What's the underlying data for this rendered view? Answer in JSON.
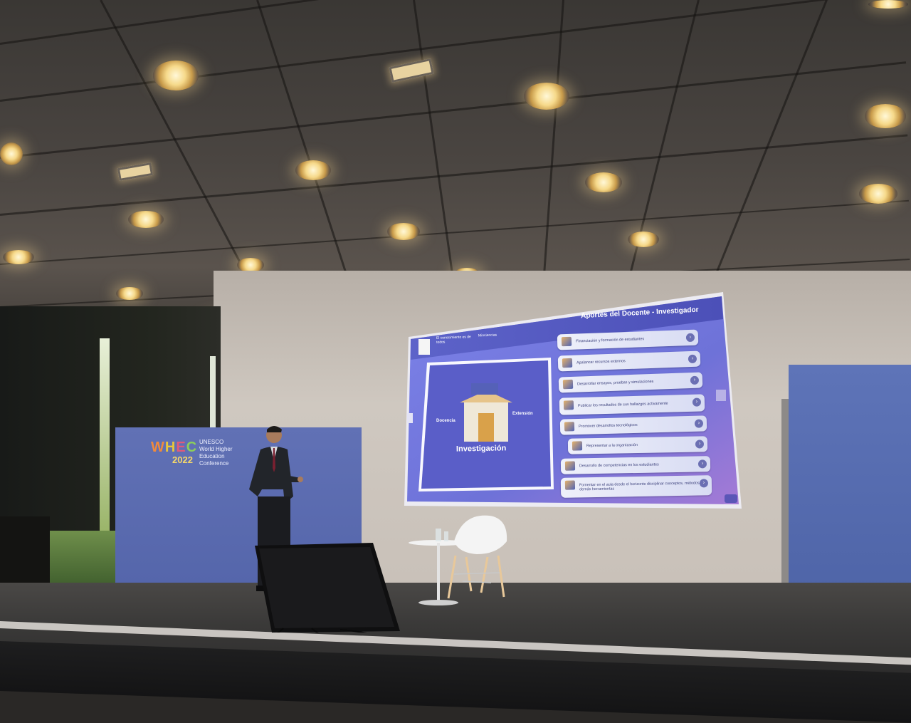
{
  "banner": {
    "logo_letters": [
      "W",
      "H",
      "E",
      "C"
    ],
    "year": "2022",
    "org_lines": [
      "UNESCO",
      "World Higher",
      "Education",
      "Conference"
    ]
  },
  "slide": {
    "title": "Aportes del Docente - Investigador",
    "brand": "El conocimiento es de todos",
    "tab": "Minciencias",
    "center_label": "Investigación",
    "left_label": "Docencia",
    "right_label": "Extensión",
    "items": [
      "Financiación y formación de estudiantes",
      "Apalancar recursos externos",
      "Desarrollar ensayos, pruebas y simulaciones",
      "Publicar los resultados de sus hallazgos activamente",
      "Promover desarrollos tecnológicos",
      "Representar a la organización",
      "Desarrollo de competencias en los estudiantes",
      "Fomentar en el aula desde el horizonte disciplinar conceptos, métodos y demás herramientas"
    ]
  },
  "colors": {
    "slide_bg": "#6e73d6",
    "banner_bg": "#5a6bb0",
    "wall": "#c8c0b8"
  }
}
